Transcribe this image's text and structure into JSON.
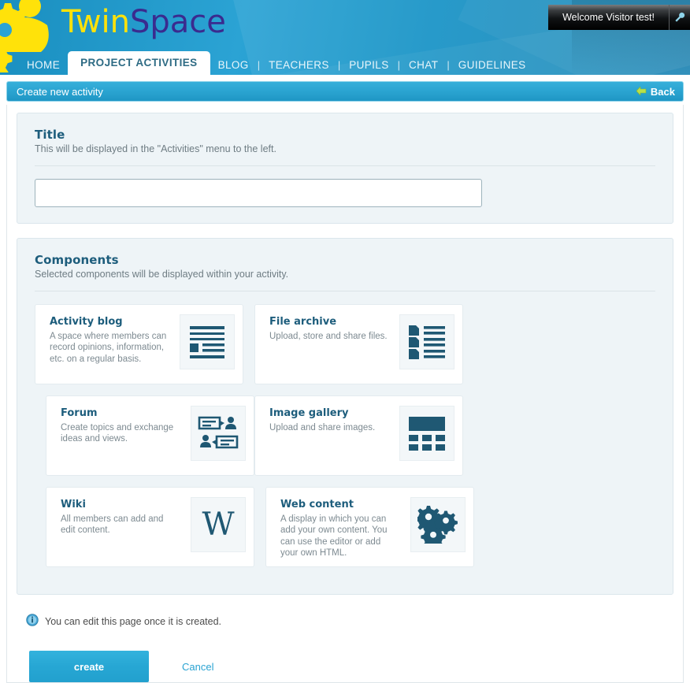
{
  "header": {
    "brand_first": "Twin",
    "brand_second": "Space",
    "welcome_text": "Welcome Visitor test!",
    "tools_icon": "wrench-icon",
    "logo_icon": "gears-person-logo",
    "nav": [
      {
        "label": "HOME",
        "active": false
      },
      {
        "label": "PROJECT ACTIVITIES",
        "active": true
      },
      {
        "label": "BLOG",
        "active": false
      },
      {
        "label": "TEACHERS",
        "active": false
      },
      {
        "label": "PUPILS",
        "active": false
      },
      {
        "label": "CHAT",
        "active": false
      },
      {
        "label": "GUIDELINES",
        "active": false
      }
    ],
    "nav_separator": "|"
  },
  "titlebar": {
    "label": "Create new activity",
    "back_label": "Back",
    "back_icon": "arrow-left-icon"
  },
  "title_panel": {
    "heading": "Title",
    "subtext": "This will be displayed in the \"Activities\" menu to the left.",
    "input_value": "",
    "input_placeholder": ""
  },
  "components_panel": {
    "heading": "Components",
    "subtext": "Selected components will be displayed within your activity.",
    "cards": [
      {
        "title": "Activity blog",
        "desc": "A space where members can record opinions, information, etc. on a regular basis.",
        "icon": "blog-lines-icon"
      },
      {
        "title": "File archive",
        "desc": "Upload, store and share files.",
        "icon": "file-list-icon"
      },
      {
        "title": "Forum",
        "desc": "Create topics and exchange ideas and views.",
        "icon": "forum-speech-bubbles-icon"
      },
      {
        "title": "Image gallery",
        "desc": "Upload and share images.",
        "icon": "image-grid-icon"
      },
      {
        "title": "Wiki",
        "desc": "All members can add and edit content.",
        "icon": "wiki-w-icon",
        "glyph": "W"
      },
      {
        "title": "Web content",
        "desc": "A display in which you can add your own content. You can use the editor or add your own HTML.",
        "icon": "gears-icon"
      }
    ]
  },
  "footer": {
    "info_icon": "info-circle-icon",
    "info_text": "You can edit this page once it is created.",
    "create_label": "create",
    "cancel_label": "Cancel"
  },
  "colors": {
    "header_blue": "#2ba3d4",
    "accent_cyan": "#27a7d4",
    "heading_blue": "#1d5d7c",
    "panel_bg": "#eef4f7",
    "icon_navy": "#1f5873",
    "logo_yellow": "#ffe20a",
    "brand_purple": "#3a2b8f"
  }
}
